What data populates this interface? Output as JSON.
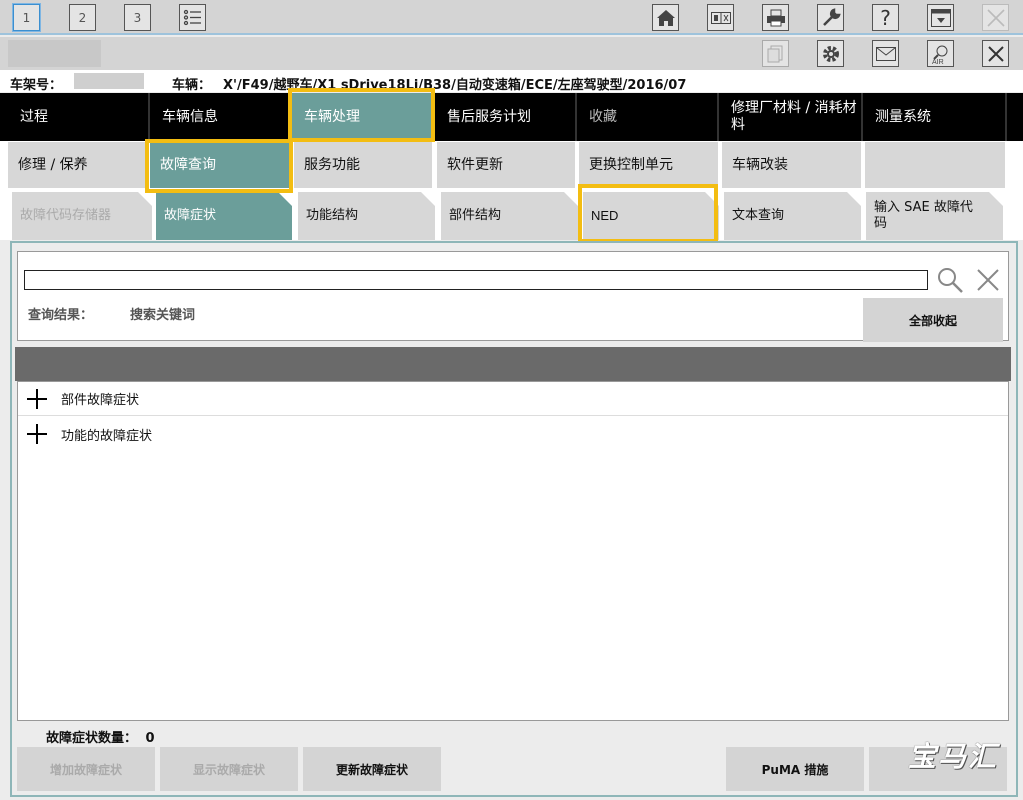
{
  "toolbar": {
    "page_tabs": [
      "1",
      "2",
      "3"
    ],
    "active_page": "1"
  },
  "vehicle_bar": {
    "vin_label": "车架号：",
    "vehicle_label": "车辆：",
    "vehicle_value": "X'/F49/越野车/X1 sDrive18Li/B38/自动变速箱/ECE/左座驾驶型/2016/07"
  },
  "nav": {
    "items": [
      "过程",
      "车辆信息",
      "车辆处理",
      "售后服务计划",
      "收藏",
      "修理厂材料 / 消耗材料",
      "测量系统"
    ],
    "selected": "车辆处理"
  },
  "subnav": {
    "items": [
      "修理 / 保养",
      "故障查询",
      "服务功能",
      "软件更新",
      "更换控制单元",
      "车辆改装",
      ""
    ],
    "selected": "故障查询"
  },
  "tabs": {
    "items": [
      "故障代码存储器",
      "故障症状",
      "功能结构",
      "部件结构",
      "NED",
      "文本查询",
      "输入 SAE 故障代码"
    ],
    "selected": "故障症状"
  },
  "search": {
    "value": "",
    "result_label": "查询结果：",
    "result_value": "搜索关键词",
    "collapse_all": "全部收起"
  },
  "tree": {
    "items": [
      "部件故障症状",
      "功能的故障症状"
    ]
  },
  "footer": {
    "count_label": "故障症状数量：",
    "count_value": "0",
    "add_button": "增加故障症状",
    "show_button": "显示故障症状",
    "update_button": "更新故障症状",
    "puma_button": "PuMA 措施"
  },
  "watermark": "宝马汇",
  "colors": {
    "selected_teal": "#6b9e9a",
    "highlight_yellow": "#f3bd12",
    "nav_black": "#000000"
  }
}
